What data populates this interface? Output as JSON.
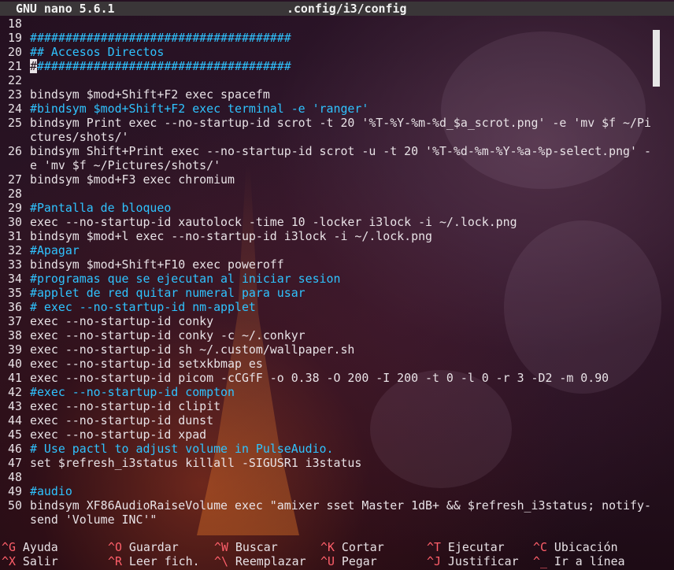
{
  "titlebar": {
    "app": "GNU nano 5.6.1",
    "file": ".config/i3/config"
  },
  "lines": [
    {
      "num": "18",
      "text": "",
      "comment": false
    },
    {
      "num": "19",
      "text": "#####################################",
      "comment": true
    },
    {
      "num": "20",
      "text": "## Accesos Directos",
      "comment": true
    },
    {
      "num": "21",
      "text": "#####################################",
      "comment": true,
      "cursor": true
    },
    {
      "num": "22",
      "text": "",
      "comment": false
    },
    {
      "num": "23",
      "text": "bindsym $mod+Shift+F2 exec spacefm",
      "comment": false
    },
    {
      "num": "24",
      "text": "#bindsym $mod+Shift+F2 exec terminal -e 'ranger'",
      "comment": true
    },
    {
      "num": "25",
      "text": "bindsym Print exec --no-startup-id scrot -t 20 '%T-%Y-%m-%d_$a_scrot.png' -e 'mv $f ~/Pi",
      "comment": false
    },
    {
      "num": "",
      "text": "ctures/shots/'",
      "comment": false
    },
    {
      "num": "26",
      "text": "bindsym Shift+Print exec --no-startup-id scrot -u -t 20 '%T-%d-%m-%Y-%a-%p-select.png' -",
      "comment": false
    },
    {
      "num": "",
      "text": "e 'mv $f ~/Pictures/shots/'",
      "comment": false
    },
    {
      "num": "27",
      "text": "bindsym $mod+F3 exec chromium",
      "comment": false
    },
    {
      "num": "28",
      "text": "",
      "comment": false
    },
    {
      "num": "29",
      "text": "#Pantalla de bloqueo",
      "comment": true
    },
    {
      "num": "30",
      "text": "exec --no-startup-id xautolock -time 10 -locker i3lock -i ~/.lock.png",
      "comment": false
    },
    {
      "num": "31",
      "text": "bindsym $mod+l exec --no-startup-id i3lock -i ~/.lock.png",
      "comment": false
    },
    {
      "num": "32",
      "text": "#Apagar",
      "comment": true
    },
    {
      "num": "33",
      "text": "bindsym $mod+Shift+F10 exec poweroff",
      "comment": false
    },
    {
      "num": "34",
      "text": "#programas que se ejecutan al iniciar sesion",
      "comment": true
    },
    {
      "num": "35",
      "text": "#applet de red quitar numeral para usar",
      "comment": true
    },
    {
      "num": "36",
      "text": "# exec --no-startup-id nm-applet",
      "comment": true
    },
    {
      "num": "37",
      "text": "exec --no-startup-id conky",
      "comment": false
    },
    {
      "num": "38",
      "text": "exec --no-startup-id conky -c ~/.conkyr",
      "comment": false
    },
    {
      "num": "39",
      "text": "exec --no-startup-id sh ~/.custom/wallpaper.sh",
      "comment": false
    },
    {
      "num": "40",
      "text": "exec --no-startup-id setxkbmap es",
      "comment": false
    },
    {
      "num": "41",
      "text": "exec --no-startup-id picom -cCGfF -o 0.38 -O 200 -I 200 -t 0 -l 0 -r 3 -D2 -m 0.90",
      "comment": false
    },
    {
      "num": "42",
      "text": "#exec --no-startup-id compton",
      "comment": true
    },
    {
      "num": "43",
      "text": "exec --no-startup-id clipit",
      "comment": false
    },
    {
      "num": "44",
      "text": "exec --no-startup-id dunst",
      "comment": false
    },
    {
      "num": "45",
      "text": "exec --no-startup-id xpad",
      "comment": false
    },
    {
      "num": "46",
      "text": "# Use pactl to adjust volume in PulseAudio.",
      "comment": true
    },
    {
      "num": "47",
      "text": "set $refresh_i3status killall -SIGUSR1 i3status",
      "comment": false
    },
    {
      "num": "48",
      "text": "",
      "comment": false
    },
    {
      "num": "49",
      "text": "#audio",
      "comment": true
    },
    {
      "num": "50",
      "text": "bindsym XF86AudioRaiseVolume exec \"amixer sset Master 1dB+ && $refresh_i3status; notify-",
      "comment": false
    },
    {
      "num": "",
      "text": "send 'Volume INC'\"",
      "comment": false
    }
  ],
  "shortcuts": [
    [
      {
        "key": "^G",
        "label": "Ayuda"
      },
      {
        "key": "^O",
        "label": "Guardar"
      },
      {
        "key": "^W",
        "label": "Buscar"
      },
      {
        "key": "^K",
        "label": "Cortar"
      },
      {
        "key": "^T",
        "label": "Ejecutar"
      },
      {
        "key": "^C",
        "label": "Ubicación"
      }
    ],
    [
      {
        "key": "^X",
        "label": "Salir"
      },
      {
        "key": "^R",
        "label": "Leer fich."
      },
      {
        "key": "^\\",
        "label": "Reemplazar"
      },
      {
        "key": "^U",
        "label": "Pegar"
      },
      {
        "key": "^J",
        "label": "Justificar"
      },
      {
        "key": "^_",
        "label": "Ir a línea"
      }
    ]
  ],
  "colors": {
    "comment": "#2fc3ff",
    "shortcut_key": "#ff5f6a",
    "titlebar_bg": "#3a3638"
  }
}
